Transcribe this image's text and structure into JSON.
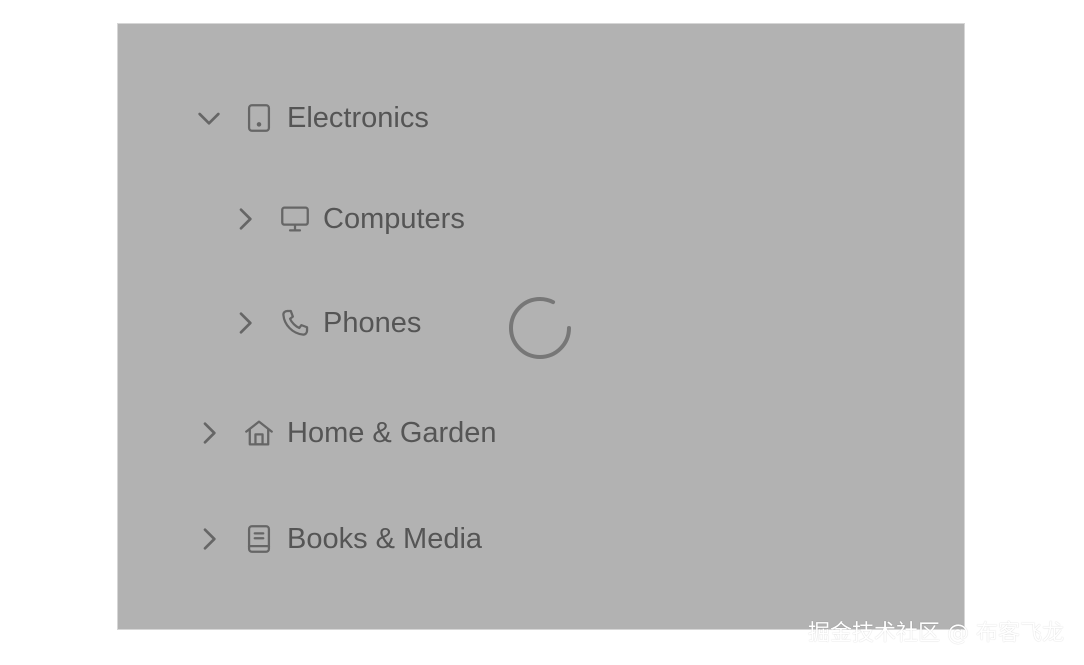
{
  "tree": {
    "nodes": [
      {
        "label": "Electronics",
        "icon": "tablet-icon",
        "toggle": "chevron-down-icon",
        "expanded": true,
        "level": 0
      },
      {
        "label": "Computers",
        "icon": "monitor-icon",
        "toggle": "chevron-right-icon",
        "expanded": false,
        "level": 1
      },
      {
        "label": "Phones",
        "icon": "phone-icon",
        "toggle": "chevron-right-icon",
        "expanded": false,
        "level": 1,
        "loading": true
      },
      {
        "label": "Home & Garden",
        "icon": "home-icon",
        "toggle": "chevron-right-icon",
        "expanded": false,
        "level": 0
      },
      {
        "label": "Books & Media",
        "icon": "book-icon",
        "toggle": "chevron-right-icon",
        "expanded": false,
        "level": 0
      }
    ]
  },
  "watermark": {
    "text": "掘金技术社区 @ 布客飞龙"
  },
  "colors": {
    "overlay": "#b2b2b2",
    "text": "#555555",
    "icon": "#666666",
    "spinner": "#777777"
  }
}
